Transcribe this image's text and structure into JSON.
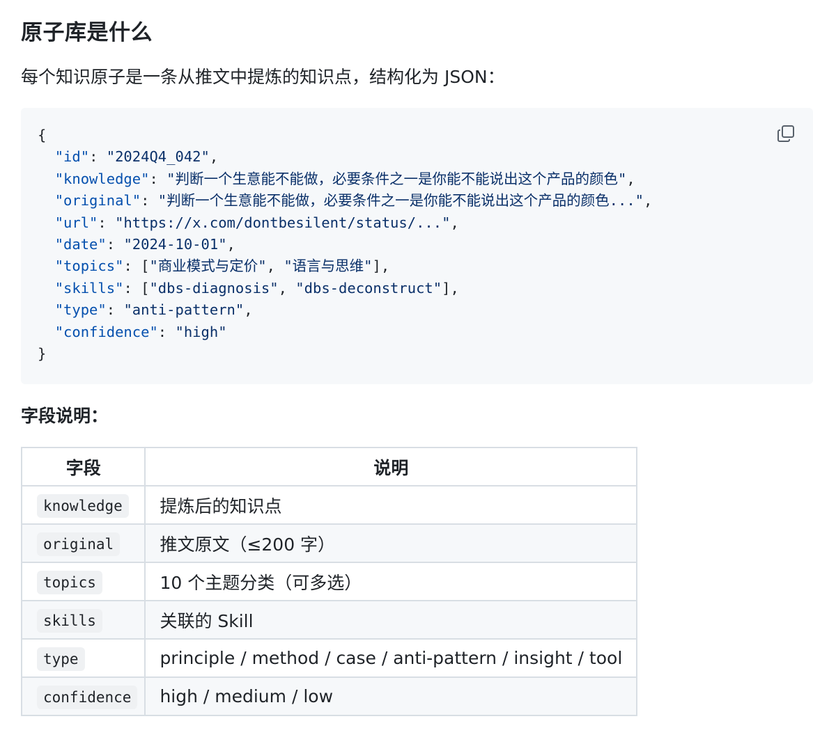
{
  "heading": "原子库是什么",
  "intro": "每个知识原子是一条从推文中提炼的知识点，结构化为 JSON：",
  "code": {
    "open_brace": "{",
    "close_brace": "}",
    "lines": [
      {
        "key": "\"id\"",
        "sep": ": ",
        "value": "\"2024Q4_042\"",
        "end": ","
      },
      {
        "key": "\"knowledge\"",
        "sep": ": ",
        "value": "\"判断一个生意能不能做，必要条件之一是你能不能说出这个产品的颜色\"",
        "end": ","
      },
      {
        "key": "\"original\"",
        "sep": ": ",
        "value": "\"判断一个生意能不能做，必要条件之一是你能不能说出这个产品的颜色...\"",
        "end": ","
      },
      {
        "key": "\"url\"",
        "sep": ": ",
        "value": "\"https://x.com/dontbesilent/status/...\"",
        "end": ","
      },
      {
        "key": "\"date\"",
        "sep": ": ",
        "value": "\"2024-10-01\"",
        "end": ","
      },
      {
        "key": "\"topics\"",
        "sep": ": [",
        "value": "\"商业模式与定价\"",
        "sep2": ", ",
        "value2": "\"语言与思维\"",
        "end": "],"
      },
      {
        "key": "\"skills\"",
        "sep": ": [",
        "value": "\"dbs-diagnosis\"",
        "sep2": ", ",
        "value2": "\"dbs-deconstruct\"",
        "end": "],"
      },
      {
        "key": "\"type\"",
        "sep": ": ",
        "value": "\"anti-pattern\"",
        "end": ","
      },
      {
        "key": "\"confidence\"",
        "sep": ": ",
        "value": "\"high\"",
        "end": ""
      }
    ],
    "copy_icon": "copy-icon"
  },
  "fields_heading": "字段说明：",
  "table": {
    "headers": [
      "字段",
      "说明"
    ],
    "rows": [
      {
        "field": "knowledge",
        "desc": "提炼后的知识点"
      },
      {
        "field": "original",
        "desc": "推文原文（≤200 字）"
      },
      {
        "field": "topics",
        "desc": "10 个主题分类（可多选）"
      },
      {
        "field": "skills",
        "desc": "关联的 Skill"
      },
      {
        "field": "type",
        "desc": "principle / method / case / anti-pattern / insight / tool"
      },
      {
        "field": "confidence",
        "desc": "high / medium / low"
      }
    ]
  },
  "colors": {
    "code_bg": "#f6f8fa",
    "key_color": "#0550ae",
    "string_color": "#0a3069",
    "table_border": "#d8dee4"
  }
}
